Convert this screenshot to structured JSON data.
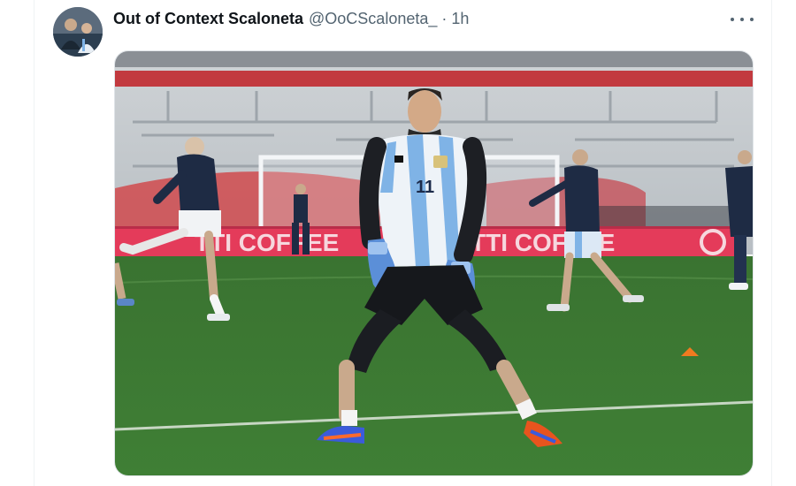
{
  "tweet": {
    "display_name": "Out of Context Scaloneta",
    "handle": "@OoCScaloneta_",
    "separator": "·",
    "time": "1h",
    "more_icon": "more-horizontal-icon"
  },
  "photo": {
    "banner_segments": [
      "TTI COFFEE",
      "TTI COFFEE"
    ],
    "jersey_number": "11",
    "colors": {
      "pitch": "#3e7a33",
      "jersey_blue": "#7fb3e6",
      "banner": "#e43b5a",
      "stand_red": "#c23a3f"
    }
  }
}
